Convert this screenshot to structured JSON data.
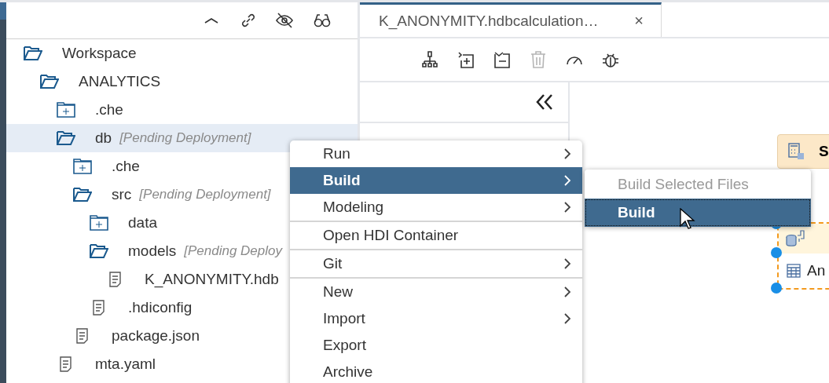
{
  "explorer": {
    "tree": [
      {
        "label": "Workspace",
        "kind": "folder",
        "expanded": true,
        "selected": false,
        "children": [
          {
            "label": "ANALYTICS",
            "kind": "folder",
            "expanded": true,
            "selected": false,
            "children": [
              {
                "label": ".che",
                "kind": "folder",
                "expanded": false,
                "selected": false
              },
              {
                "label": "db",
                "status": "[Pending Deployment]",
                "kind": "folder",
                "expanded": true,
                "selected": true,
                "children": [
                  {
                    "label": ".che",
                    "kind": "folder",
                    "expanded": false,
                    "selected": false
                  },
                  {
                    "label": "src",
                    "status": "[Pending Deployment]",
                    "kind": "folder",
                    "expanded": true,
                    "selected": false,
                    "children": [
                      {
                        "label": "data",
                        "kind": "folder",
                        "expanded": false,
                        "selected": false
                      },
                      {
                        "label": "models",
                        "status": "[Pending Deploy",
                        "kind": "folder",
                        "expanded": true,
                        "selected": false,
                        "children": [
                          {
                            "label": "K_ANONYMITY.hdb",
                            "kind": "file",
                            "selected": false
                          }
                        ]
                      },
                      {
                        "label": ".hdiconfig",
                        "kind": "file",
                        "selected": false
                      }
                    ]
                  },
                  {
                    "label": "package.json",
                    "kind": "file",
                    "selected": false
                  }
                ]
              },
              {
                "label": "mta.yaml",
                "kind": "file",
                "selected": false
              }
            ]
          }
        ]
      }
    ]
  },
  "editor": {
    "tabs": [
      {
        "label": "K_ANONYMITY.hdbcalculation…",
        "close": "×",
        "selected": true
      }
    ],
    "toolbar": [
      {
        "kind": "hierarchy",
        "disabled": false
      },
      {
        "kind": "add",
        "disabled": false
      },
      {
        "kind": "remove",
        "disabled": false
      },
      {
        "kind": "delete",
        "disabled": true
      },
      {
        "kind": "gauge",
        "disabled": false
      },
      {
        "kind": "debug",
        "disabled": false
      }
    ],
    "canvas": {
      "nodes": [
        {
          "kind": "projection",
          "title": "S"
        },
        {
          "kind": "source",
          "row": "An",
          "selected": true
        }
      ]
    }
  },
  "context_menu": {
    "items": [
      {
        "kind": "item",
        "label": "Run",
        "submenu": true,
        "selected": false
      },
      {
        "kind": "item",
        "label": "Build",
        "submenu": true,
        "selected": true
      },
      {
        "kind": "item",
        "label": "Modeling",
        "submenu": true,
        "selected": false
      },
      {
        "kind": "separator"
      },
      {
        "kind": "item",
        "label": "Open HDI Container",
        "submenu": false,
        "selected": false
      },
      {
        "kind": "separator"
      },
      {
        "kind": "item",
        "label": "Git",
        "submenu": true,
        "selected": false
      },
      {
        "kind": "separator"
      },
      {
        "kind": "item",
        "label": "New",
        "submenu": true,
        "selected": false
      },
      {
        "kind": "item",
        "label": "Import",
        "submenu": true,
        "selected": false
      },
      {
        "kind": "item",
        "label": "Export",
        "submenu": false,
        "selected": false
      },
      {
        "kind": "item",
        "label": "Archive",
        "submenu": false,
        "selected": false
      }
    ]
  },
  "submenu": {
    "items": [
      {
        "label": "Build Selected Files",
        "disabled": true,
        "selected": false
      },
      {
        "label": "Build",
        "disabled": false,
        "selected": true
      }
    ]
  }
}
